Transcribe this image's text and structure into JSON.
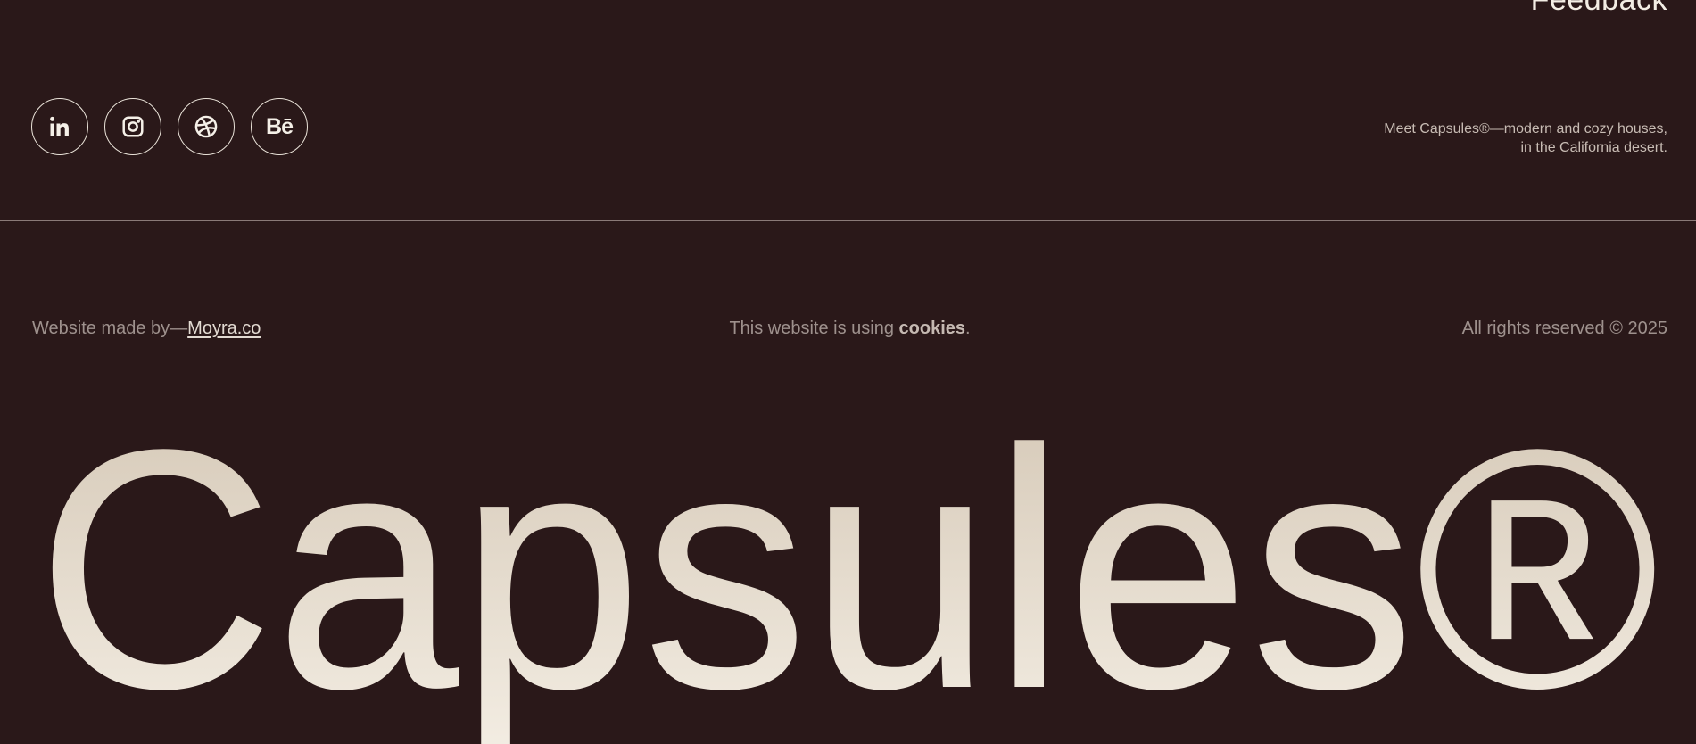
{
  "header": {
    "feedback_link": "Feedback"
  },
  "social": {
    "items": [
      {
        "name": "LinkedIn",
        "icon": "linkedin-icon"
      },
      {
        "name": "Instagram",
        "icon": "instagram-icon"
      },
      {
        "name": "Dribbble",
        "icon": "dribbble-icon"
      },
      {
        "name": "Behance",
        "icon": "behance-icon",
        "glyph": "Bē"
      }
    ]
  },
  "tagline": {
    "line1": "Meet Capsules®—modern and cozy houses,",
    "line2": "in the California desert."
  },
  "footer": {
    "made_by_prefix": "Website made by—",
    "made_by_link": "Moyra.co",
    "cookies_prefix": "This website is using ",
    "cookies_link": "cookies",
    "cookies_suffix": ".",
    "rights": "All rights reserved © 2025"
  },
  "brand": {
    "wordmark": "Capsules®"
  },
  "colors": {
    "background": "#2a1819",
    "text_light": "#f1ebe2",
    "muted": "#9e918d",
    "wordmark_top": "#d6c9b8",
    "wordmark_bottom": "#f3ede3"
  }
}
